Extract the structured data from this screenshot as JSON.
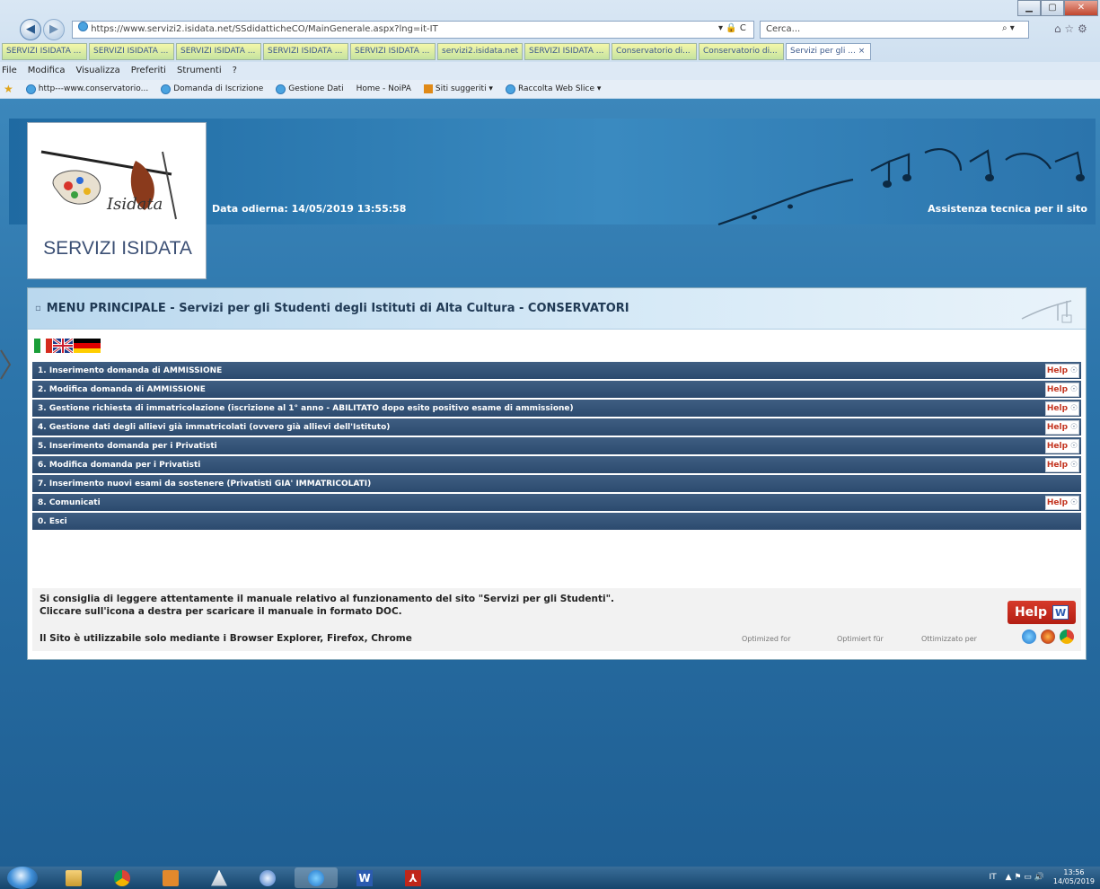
{
  "browser": {
    "address": "https://www.servizi2.isidata.net/SSdidatticheCO/MainGenerale.aspx?lng=it-IT",
    "address_controls": "▾ 🔒 C",
    "search_placeholder": "Cerca...",
    "search_controls": "⌕ ▾",
    "tabs": [
      "SERVIZI ISIDATA ...",
      "SERVIZI ISIDATA ...",
      "SERVIZI ISIDATA ...",
      "SERVIZI ISIDATA ...",
      "SERVIZI ISIDATA ...",
      "servizi2.isidata.net",
      "SERVIZI ISIDATA ...",
      "Conservatorio di...",
      "Conservatorio di...",
      "Servizi per gli ... ×"
    ],
    "menu": [
      "File",
      "Modifica",
      "Visualizza",
      "Preferiti",
      "Strumenti",
      "?"
    ],
    "favorites": [
      "http---www.conservatorio...",
      "Domanda di Iscrizione",
      "Gestione Dati",
      "Home - NoiPA",
      "Siti suggeriti ▾",
      "Raccolta Web Slice ▾"
    ]
  },
  "header": {
    "logo_text": "SERVIZI ISIDATA",
    "logo_brand": "Isidata",
    "date_label": "Data odierna: 14/05/2019 13:55:58",
    "assistance": "Assistenza tecnica per il sito"
  },
  "panel": {
    "title": "MENU PRINCIPALE - Servizi per gli Studenti degli Istituti di Alta Cultura - CONSERVATORI",
    "menu_items": [
      {
        "label": "1. Inserimento domanda di AMMISSIONE",
        "help": true
      },
      {
        "label": "2. Modifica domanda di AMMISSIONE",
        "help": true
      },
      {
        "label": "3. Gestione richiesta di immatricolazione (iscrizione al 1° anno - ABILITATO dopo esito positivo esame di ammissione)",
        "help": true
      },
      {
        "label": "4. Gestione dati degli allievi già immatricolati (ovvero già allievi dell'Istituto)",
        "help": true
      },
      {
        "label": "5. Inserimento domanda per i Privatisti",
        "help": true
      },
      {
        "label": "6. Modifica domanda per i Privatisti",
        "help": true
      },
      {
        "label": "7. Inserimento nuovi esami da sostenere (Privatisti GIA' IMMATRICOLATI)",
        "help": false
      },
      {
        "label": "8. Comunicati",
        "help": true
      },
      {
        "label": "0. Esci",
        "help": false
      }
    ],
    "help_label": "Help",
    "info_line1": "Si consiglia di leggere attentamente il manuale relativo al funzionamento del sito \"Servizi per gli Studenti\".",
    "info_line2": "Cliccare sull'icona a destra per scaricare il manuale in formato DOC.",
    "info_line3": "Il Sito è utilizzabile solo mediante i Browser Explorer, Firefox, Chrome",
    "big_help": "Help",
    "optimized": [
      "Optimized for",
      "Optimiert für",
      "Ottimizzato per"
    ]
  },
  "taskbar": {
    "tray_lang": "IT",
    "tray_symbols": "▲ ⚑ ▭ 🔊",
    "time": "13:56",
    "date": "14/05/2019"
  },
  "colors": {
    "menu_row": "#2c4a6e",
    "help_text": "#c3341f",
    "page_bg": "#2b73a9"
  }
}
